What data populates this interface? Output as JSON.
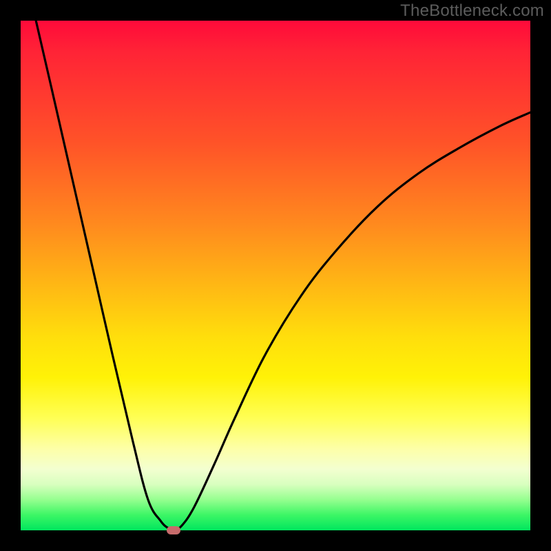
{
  "watermark": "TheBottleneck.com",
  "chart_data": {
    "type": "line",
    "title": "",
    "xlabel": "",
    "ylabel": "",
    "xlim": [
      0,
      100
    ],
    "ylim": [
      0,
      100
    ],
    "grid": false,
    "legend": false,
    "series": [
      {
        "name": "left-branch",
        "x": [
          3.0,
          6.0,
          10.0,
          14.0,
          18.0,
          22.0,
          25.0,
          27.5,
          29.0,
          30.0
        ],
        "y": [
          100.0,
          87.0,
          69.5,
          52.0,
          34.5,
          17.5,
          6.0,
          1.8,
          0.4,
          0.0
        ]
      },
      {
        "name": "right-branch",
        "x": [
          30.0,
          31.5,
          34.0,
          38.0,
          42.0,
          48.0,
          55.0,
          62.0,
          70.0,
          78.0,
          86.0,
          94.0,
          100.0
        ],
        "y": [
          0.0,
          0.8,
          4.5,
          13.0,
          22.0,
          34.5,
          46.0,
          55.0,
          63.5,
          70.0,
          75.0,
          79.3,
          82.0
        ]
      }
    ],
    "marker": {
      "x": 30.0,
      "y": 0.0,
      "color": "#c76b6b"
    },
    "background_gradient": {
      "top": "#ff0a3a",
      "mid": "#ffde0c",
      "bottom": "#00e65e"
    },
    "curve_color": "#000000"
  }
}
